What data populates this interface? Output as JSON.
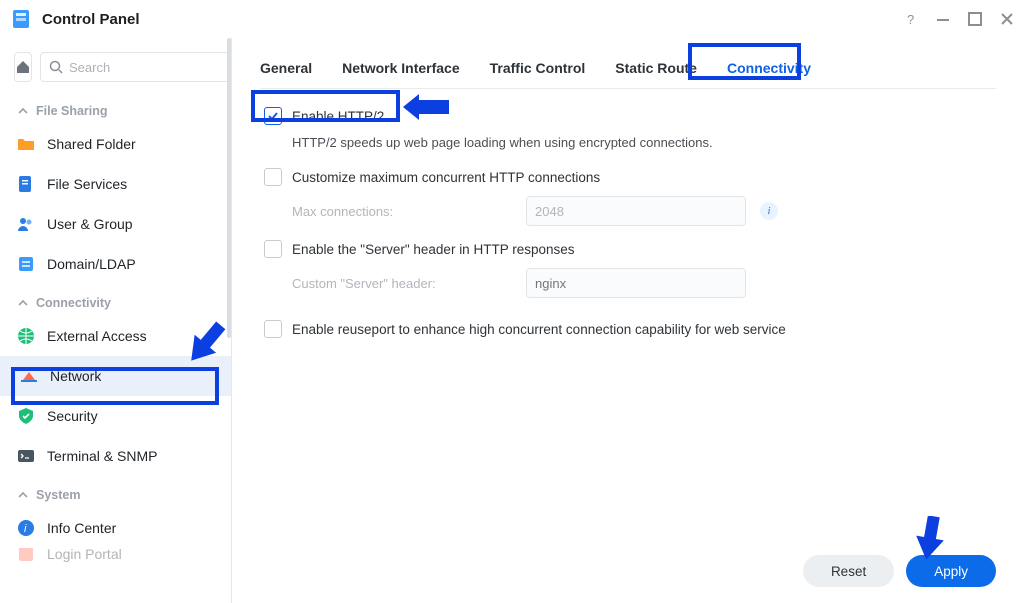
{
  "window": {
    "title": "Control Panel"
  },
  "search": {
    "placeholder": "Search"
  },
  "sidebar": {
    "groups": [
      {
        "label": "File Sharing",
        "items": [
          {
            "label": "Shared Folder",
            "icon": "folder"
          },
          {
            "label": "File Services",
            "icon": "fileservices"
          },
          {
            "label": "User & Group",
            "icon": "usergroup"
          },
          {
            "label": "Domain/LDAP",
            "icon": "domain"
          }
        ]
      },
      {
        "label": "Connectivity",
        "items": [
          {
            "label": "External Access",
            "icon": "globe"
          },
          {
            "label": "Network",
            "icon": "network",
            "active": true
          },
          {
            "label": "Security",
            "icon": "shield"
          },
          {
            "label": "Terminal & SNMP",
            "icon": "terminal"
          }
        ]
      },
      {
        "label": "System",
        "items": [
          {
            "label": "Info Center",
            "icon": "info"
          },
          {
            "label": "Login Portal",
            "icon": "loginportal"
          }
        ]
      }
    ]
  },
  "tabs": {
    "items": [
      {
        "label": "General"
      },
      {
        "label": "Network Interface"
      },
      {
        "label": "Traffic Control"
      },
      {
        "label": "Static Route"
      },
      {
        "label": "Connectivity",
        "active": true
      }
    ]
  },
  "form": {
    "enable_http2": {
      "label": "Enable HTTP/2",
      "checked": true
    },
    "http2_desc": "HTTP/2 speeds up web page loading when using encrypted connections.",
    "customize_max": {
      "label": "Customize maximum concurrent HTTP connections",
      "checked": false
    },
    "max_conn": {
      "label": "Max connections:",
      "value": "2048"
    },
    "server_header": {
      "label": "Enable the \"Server\" header in HTTP responses",
      "checked": false
    },
    "custom_header": {
      "label": "Custom \"Server\" header:",
      "placeholder": "nginx"
    },
    "reuseport": {
      "label": "Enable reuseport to enhance high concurrent connection capability for web service",
      "checked": false
    }
  },
  "footer": {
    "reset": "Reset",
    "apply": "Apply"
  },
  "colors": {
    "accent": "#0b6be8",
    "highlight": "#0b3fe0"
  }
}
